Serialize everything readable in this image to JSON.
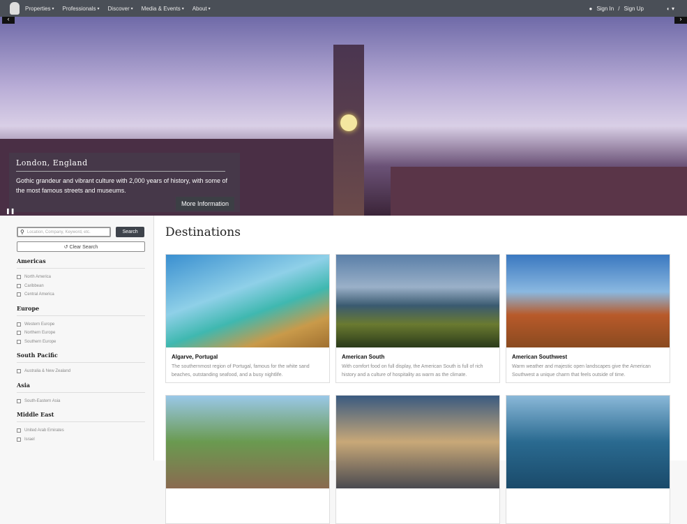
{
  "nav": {
    "items": [
      "Properties",
      "Professionals",
      "Discover",
      "Media & Events",
      "About"
    ],
    "sign_in": "Sign In",
    "separator": "/",
    "sign_up": "Sign Up"
  },
  "hero": {
    "title": "London, England",
    "text": "Gothic grandeur and vibrant culture with 2,000 years of history, with some of the most famous streets and museums.",
    "button": "More Information",
    "prev": "‹",
    "next": "›",
    "pause": "❚❚"
  },
  "sidebar": {
    "search_placeholder": "Location, Company, Keyword, etc.",
    "search_button": "Search",
    "clear_button": "↺ Clear Search",
    "regions": [
      {
        "name": "Americas",
        "items": [
          "North America",
          "Caribbean",
          "Central America"
        ]
      },
      {
        "name": "Europe",
        "items": [
          "Western Europe",
          "Northern Europe",
          "Southern Europe"
        ]
      },
      {
        "name": "South Pacific",
        "items": [
          "Australia & New Zealand"
        ]
      },
      {
        "name": "Asia",
        "items": [
          "South-Eastern Asia"
        ]
      },
      {
        "name": "Middle East",
        "items": [
          "United Arab Emirates",
          "Israel"
        ]
      }
    ]
  },
  "main": {
    "title": "Destinations",
    "cards": [
      {
        "title": "Algarve, Portugal",
        "text": "The southernmost region of Portugal, famous for the white sand beaches, outstanding seafood, and a busy nightlife."
      },
      {
        "title": "American South",
        "text": "With comfort food on full display, the American South is full of rich history and a culture of hospitality as warm as the climate."
      },
      {
        "title": "American Southwest",
        "text": "Warm weather and majestic open landscapes give the American Southwest a unique charm that feels outside of time."
      },
      {
        "title": "",
        "text": ""
      },
      {
        "title": "",
        "text": ""
      },
      {
        "title": "",
        "text": ""
      }
    ]
  }
}
